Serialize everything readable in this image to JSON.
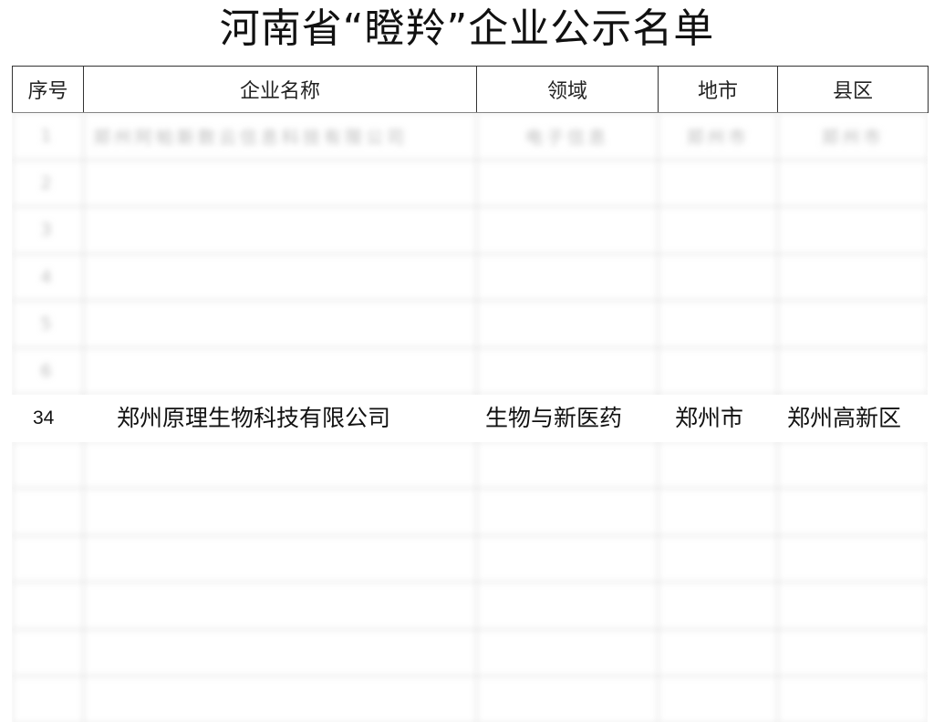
{
  "document": {
    "title": "河南省“瞪羚”企业公示名单"
  },
  "table": {
    "headers": [
      "序号",
      "企业名称",
      "领域",
      "地市",
      "县区"
    ],
    "blurred_rows": [
      [
        "1",
        "郑州阿帕斯数云信息科技有限公司",
        "电子信息",
        "郑州市",
        "郑州市"
      ],
      [
        "2",
        "",
        "",
        "",
        ""
      ],
      [
        "3",
        "",
        "",
        "",
        ""
      ],
      [
        "4",
        "",
        "",
        "",
        ""
      ],
      [
        "5",
        "",
        "",
        "",
        ""
      ],
      [
        "6",
        "",
        "",
        "",
        ""
      ],
      [
        "",
        "",
        "",
        "",
        ""
      ],
      [
        "",
        "",
        "",
        "",
        ""
      ],
      [
        "",
        "",
        "",
        "",
        ""
      ],
      [
        "",
        "",
        "",
        "",
        ""
      ],
      [
        "",
        "",
        "",
        "",
        ""
      ],
      [
        "",
        "",
        "",
        "",
        ""
      ],
      [
        "",
        "",
        "",
        "",
        ""
      ]
    ],
    "highlighted_row": {
      "seq": "34",
      "name": "郑州原理生物科技有限公司",
      "field": "生物与新医药",
      "city": "郑州市",
      "county": "郑州高新区"
    }
  }
}
